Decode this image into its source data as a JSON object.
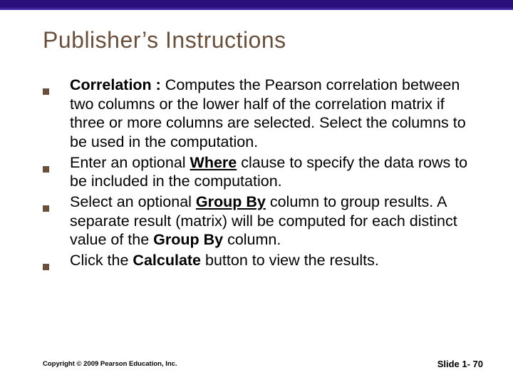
{
  "title": "Publisher’s Instructions",
  "bullets": {
    "b0": {
      "lead": "Correlation : ",
      "text": "Computes the Pearson correlation between two columns or the lower half of the correlation matrix if three or more columns are selected. Select the columns to be used in the computation."
    },
    "b1": {
      "pre": "Enter an optional ",
      "key": "Where",
      "post": " clause to specify the data rows to be included in the computation."
    },
    "b2": {
      "pre": "Select an optional ",
      "key": "Group By",
      "mid": " column to group results. A separate result (matrix) will be computed for each distinct value of the ",
      "key2": "Group By",
      "post": " column."
    },
    "b3": {
      "pre": "Click the ",
      "key": "Calculate",
      "post": " button to view the results."
    }
  },
  "footer": {
    "copyright": "Copyright © 2009 Pearson Education, Inc.",
    "slide": "Slide 1- 70"
  }
}
